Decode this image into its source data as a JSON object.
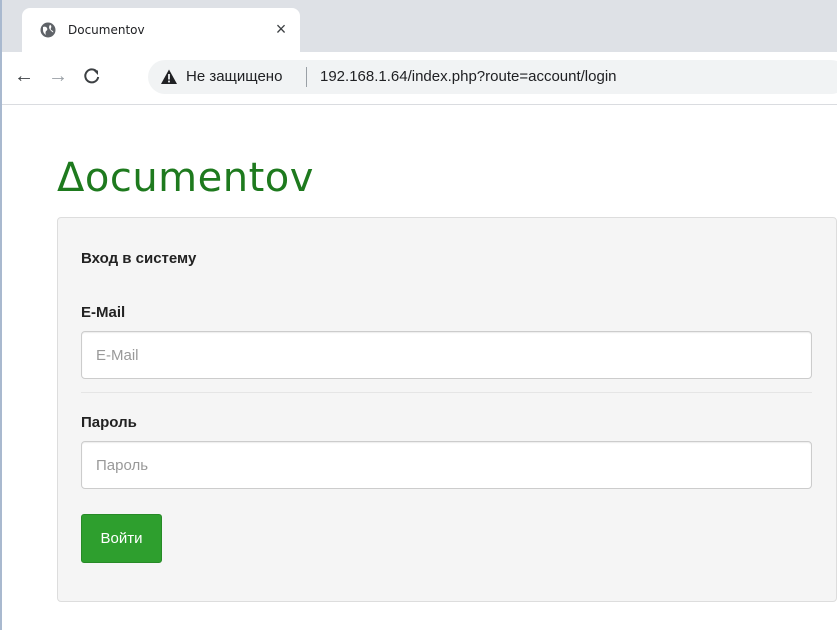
{
  "browser": {
    "tab": {
      "title": "Documentov",
      "close_label": "×"
    },
    "toolbar": {
      "back_label": "←",
      "forward_label": "→",
      "reload_label": "C"
    },
    "address_bar": {
      "security_text": "Не защищено",
      "url": "192.168.1.64/index.php?route=account/login"
    }
  },
  "page": {
    "logo": "Δocumentov",
    "login_panel": {
      "heading": "Вход в систему",
      "email": {
        "label": "E-Mail",
        "placeholder": "E-Mail",
        "value": ""
      },
      "password": {
        "label": "Пароль",
        "placeholder": "Пароль",
        "value": ""
      },
      "submit_label": "Войти"
    }
  },
  "colors": {
    "brand_green": "#1e7a1e",
    "button_green": "#2e9f2e",
    "panel_bg": "#f5f5f5"
  }
}
